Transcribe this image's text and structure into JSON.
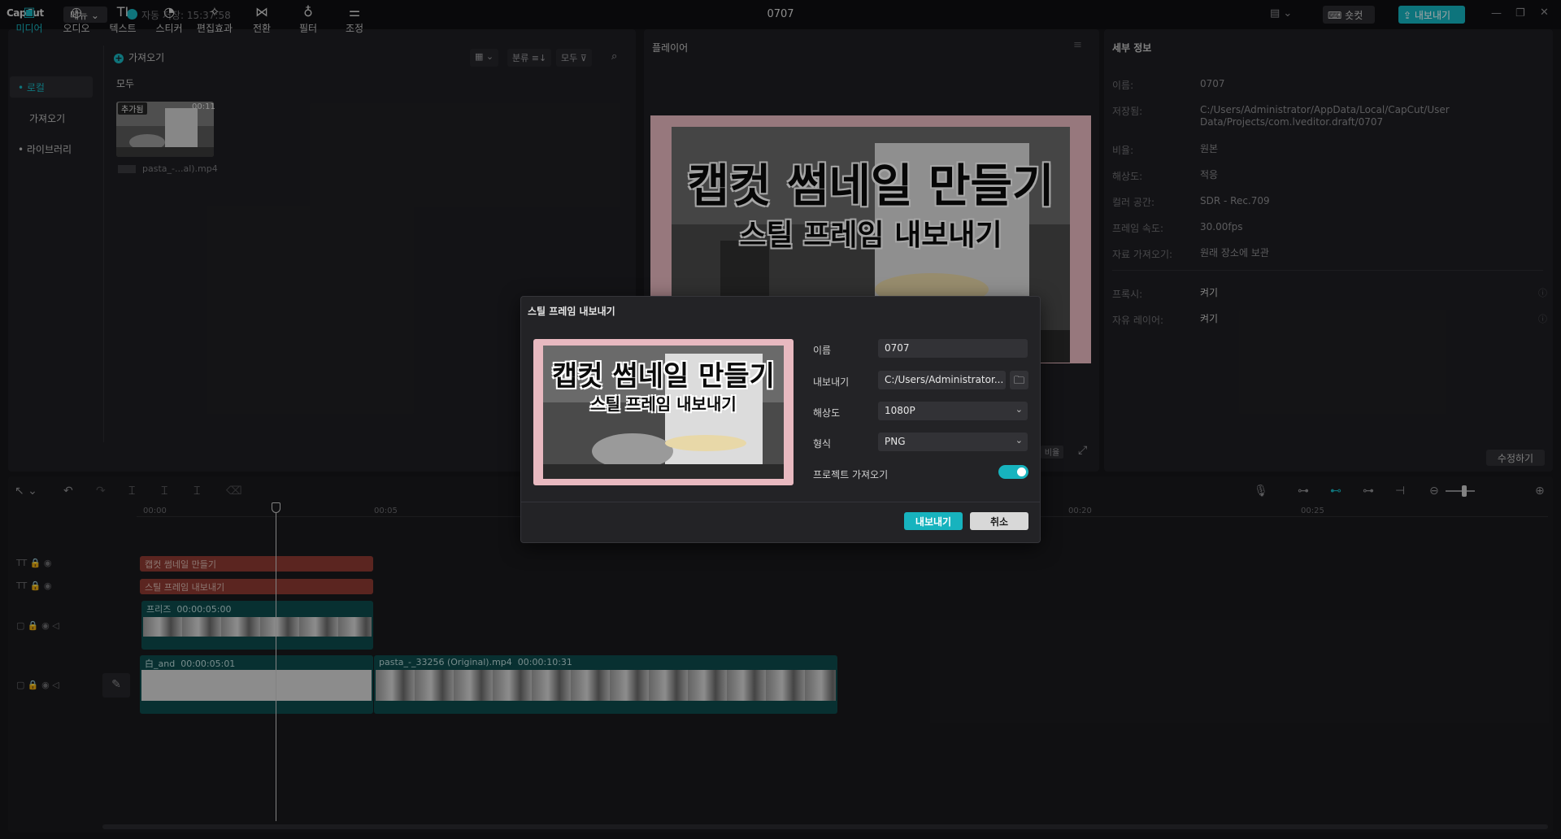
{
  "titlebar": {
    "logo": "CapCut",
    "menu": "메뉴",
    "autosave": "자동 저장: 15:37:58",
    "title": "0707",
    "shortcut": "숏컷",
    "export": "내보내기"
  },
  "tools": [
    {
      "label": "미디어",
      "icon": "media-icon"
    },
    {
      "label": "오디오",
      "icon": "audio-icon"
    },
    {
      "label": "텍스트",
      "icon": "text-icon"
    },
    {
      "label": "스티커",
      "icon": "sticker-icon"
    },
    {
      "label": "편집효과",
      "icon": "effects-icon"
    },
    {
      "label": "전환",
      "icon": "transition-icon"
    },
    {
      "label": "필터",
      "icon": "filter-icon"
    },
    {
      "label": "조정",
      "icon": "adjust-icon"
    }
  ],
  "media_panel": {
    "nav": {
      "local": "• 로컬",
      "import": "가져오기",
      "library": "• 라이브러리"
    },
    "import_label": "가져오기",
    "sort_label": "분류",
    "filter_label": "모두",
    "section_all": "모두",
    "item": {
      "badge": "추가됨",
      "duration": "00:11",
      "name": "pasta_-...al).mp4"
    }
  },
  "player": {
    "title": "플레이어",
    "headline": "캡컷 썸네일 만들기",
    "subline": "스틸 프레임 내보내기",
    "ratio": "비율"
  },
  "details": {
    "title": "세부 정보",
    "rows": [
      {
        "label": "이름:",
        "value": "0707"
      },
      {
        "label": "저장됨:",
        "value": "C:/Users/Administrator/AppData/Local/CapCut/User Data/Projects/com.lveditor.draft/0707"
      },
      {
        "label": "비율:",
        "value": "원본"
      },
      {
        "label": "해상도:",
        "value": "적응"
      },
      {
        "label": "컬러 공간:",
        "value": "SDR - Rec.709"
      },
      {
        "label": "프레임 속도:",
        "value": "30.00fps"
      },
      {
        "label": "자료 가져오기:",
        "value": "원래 장소에 보관"
      },
      {
        "label": "프록시:",
        "value": "켜기"
      },
      {
        "label": "자유 레이어:",
        "value": "켜기"
      }
    ],
    "edit": "수정하기"
  },
  "timeline": {
    "ruler": [
      "00:00",
      "00:05",
      "00:20",
      "00:25"
    ],
    "text_clips": [
      "캡컷 썸네일 만들기",
      "스틸 프레임 내보내기"
    ],
    "freeze_clip": {
      "name": "프리즈",
      "duration": "00:00:05:00"
    },
    "main_clips": [
      {
        "name": "白_and",
        "duration": "00:00:05:01"
      },
      {
        "name": "pasta_-_33256 (Original).mp4",
        "duration": "00:00:10:31"
      }
    ]
  },
  "dialog": {
    "title": "스틸 프레임 내보내기",
    "fields": {
      "name_label": "이름",
      "name_value": "0707",
      "export_label": "내보내기",
      "export_path": "C:/Users/Administrator...",
      "resolution_label": "해상도",
      "resolution_value": "1080P",
      "format_label": "형식",
      "format_value": "PNG",
      "import_label": "프로젝트 가져오기"
    },
    "export_btn": "내보내기",
    "cancel_btn": "취소"
  },
  "colors": {
    "accent": "#17b3be",
    "text_clip": "#8c3a32",
    "video_clip": "#0d4a4c",
    "frame_pink": "#e8b9c0"
  }
}
